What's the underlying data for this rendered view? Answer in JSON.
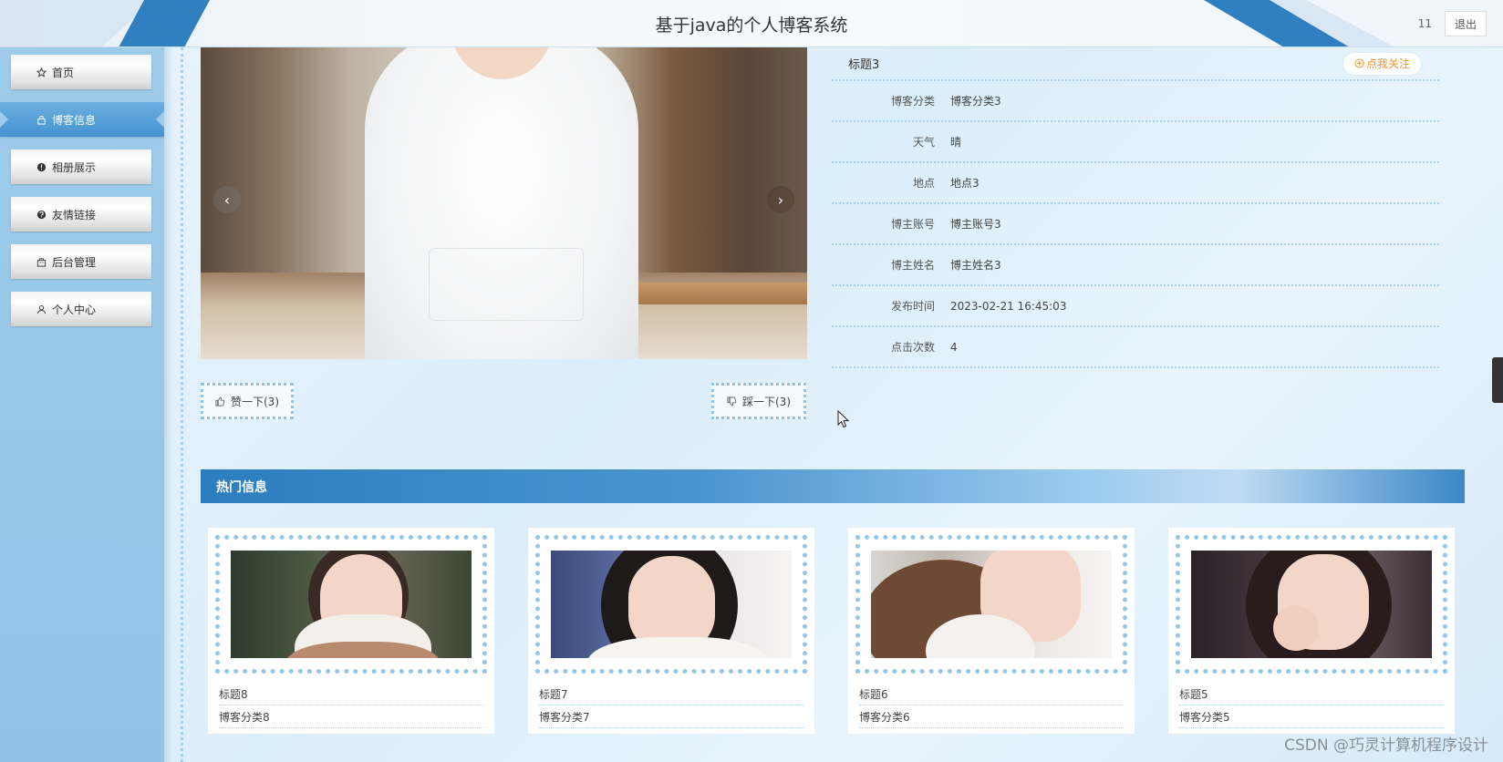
{
  "header": {
    "title": "基于java的个人博客系统",
    "user": "11",
    "logout": "退出"
  },
  "sidebar": {
    "items": [
      {
        "label": "首页",
        "icon": "star-icon"
      },
      {
        "label": "博客信息",
        "icon": "lock-icon",
        "active": true
      },
      {
        "label": "相册展示",
        "icon": "exclamation-icon"
      },
      {
        "label": "友情链接",
        "icon": "question-icon"
      },
      {
        "label": "后台管理",
        "icon": "building-icon"
      },
      {
        "label": "个人中心",
        "icon": "user-icon"
      }
    ]
  },
  "carousel": {
    "prev": "‹",
    "next": "›"
  },
  "votes": {
    "like": "赞一下(3)",
    "dislike": "踩一下(3)"
  },
  "detail": {
    "title": "标题3",
    "follow": "点我关注",
    "rows": [
      {
        "label": "博客分类",
        "value": "博客分类3"
      },
      {
        "label": "天气",
        "value": "晴"
      },
      {
        "label": "地点",
        "value": "地点3"
      },
      {
        "label": "博主账号",
        "value": "博主账号3"
      },
      {
        "label": "博主姓名",
        "value": "博主姓名3"
      },
      {
        "label": "发布时间",
        "value": "2023-02-21 16:45:03"
      },
      {
        "label": "点击次数",
        "value": "4"
      }
    ]
  },
  "hot": {
    "title": "热门信息",
    "cards": [
      {
        "title": "标题8",
        "category": "博客分类8"
      },
      {
        "title": "标题7",
        "category": "博客分类7"
      },
      {
        "title": "标题6",
        "category": "博客分类6"
      },
      {
        "title": "标题5",
        "category": "博客分类5"
      }
    ]
  },
  "watermark": "CSDN @巧灵计算机程序设计",
  "colors": {
    "primary": "#2f7fc1",
    "accent": "#f0932b",
    "sidebar": "#9fcbea"
  }
}
